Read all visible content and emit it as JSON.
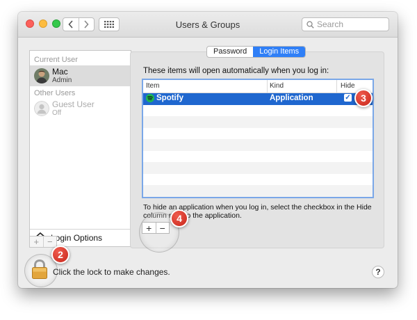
{
  "window": {
    "title": "Users & Groups"
  },
  "search": {
    "placeholder": "Search"
  },
  "sidebar": {
    "current_user_label": "Current User",
    "current_user": {
      "name": "Mac",
      "role": "Admin"
    },
    "other_users_label": "Other Users",
    "other_users": [
      {
        "name": "Guest User",
        "role": "Off"
      }
    ],
    "login_options_label": "Login Options"
  },
  "tabs": [
    {
      "label": "Password",
      "active": false
    },
    {
      "label": "Login Items",
      "active": true
    }
  ],
  "login_items": {
    "intro": "These items will open automatically when you log in:",
    "columns": {
      "item": "Item",
      "kind": "Kind",
      "hide": "Hide"
    },
    "rows": [
      {
        "item": "Spotify",
        "kind": "Application",
        "hide": true,
        "icon": "spotify-icon"
      }
    ],
    "hint": "To hide an application when you log in, select the checkbox in the Hide column next to the application."
  },
  "footer": {
    "lock_text": "Click the lock to make changes.",
    "help_label": "?"
  },
  "annotations": {
    "marker_2": "2",
    "marker_3": "3",
    "marker_4": "4"
  },
  "colors": {
    "selection": "#1f67cf",
    "tab_active": "#2f7ff7",
    "annotation": "#d93a2c",
    "spotify": "#1db954"
  }
}
